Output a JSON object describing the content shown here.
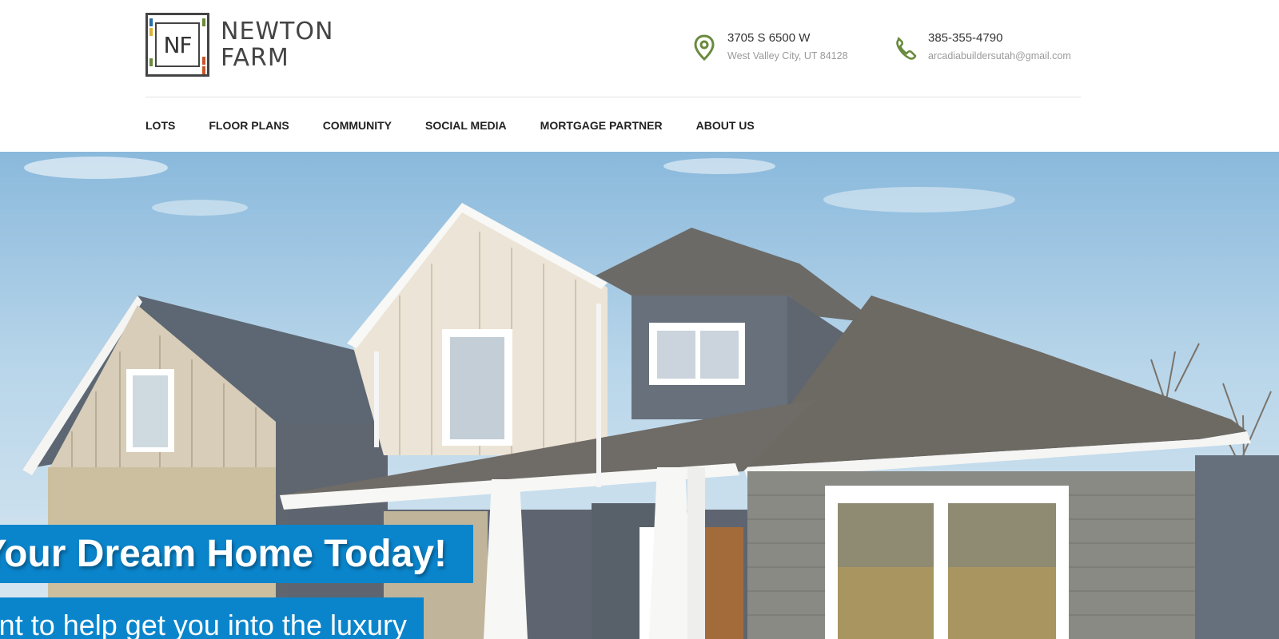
{
  "brand": {
    "monogram": "NF",
    "name_line1": "NEWTON",
    "name_line2": "FARM",
    "colors": {
      "accent_green": "#6a8a3d",
      "banner_blue": "#0a85cc"
    }
  },
  "contact": {
    "address": {
      "icon": "map-pin-icon",
      "line1": "3705 S 6500 W",
      "line2": "West Valley City, UT 84128"
    },
    "phone": {
      "icon": "phone-icon",
      "line1": "385-355-4790",
      "line2": "arcadiabuildersutah@gmail.com"
    }
  },
  "nav": {
    "items": [
      {
        "label": "LOTS"
      },
      {
        "label": "FLOOR PLANS"
      },
      {
        "label": "COMMUNITY"
      },
      {
        "label": "SOCIAL MEDIA"
      },
      {
        "label": "MORTGAGE PARTNER"
      },
      {
        "label": "ABOUT US"
      }
    ]
  },
  "hero": {
    "title": "Find Your Dream Home Today!",
    "subtitle": "We want to help get you into the luxury"
  }
}
